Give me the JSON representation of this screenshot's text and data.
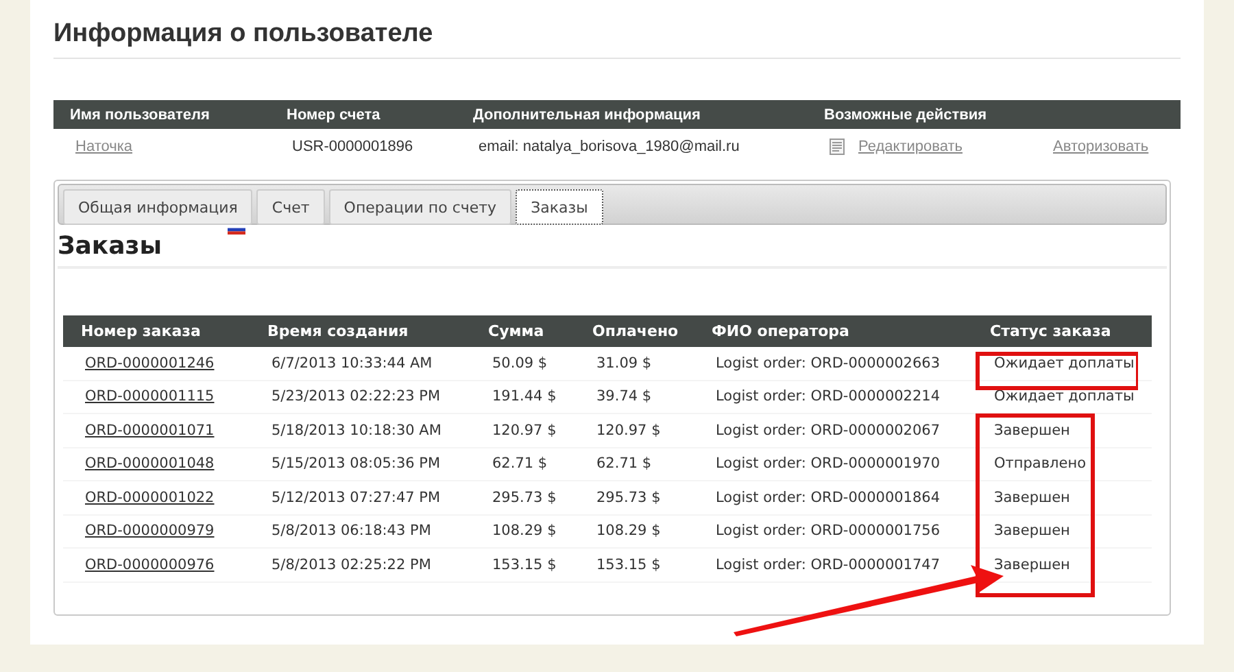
{
  "page_title": "Информация о пользователе",
  "user_table": {
    "columns": [
      "Имя пользователя",
      "Номер счета",
      "Дополнительная информация",
      "Возможные действия"
    ],
    "row": {
      "name": "Наточка",
      "account": "USR-0000001896",
      "info": "email: natalya_borisova_1980@mail.ru",
      "actions": [
        "Редактировать",
        "Авторизовать"
      ]
    }
  },
  "tabs": [
    {
      "label": "Общая информация",
      "selected": false
    },
    {
      "label": "Счет",
      "selected": false
    },
    {
      "label": "Операции по счету",
      "selected": false
    },
    {
      "label": "Заказы",
      "selected": true
    }
  ],
  "section_title": "Заказы",
  "orders": {
    "columns": [
      "Номер заказа",
      "Время создания",
      "Сумма",
      "Оплачено",
      "ФИО оператора",
      "Статус заказа"
    ],
    "rows": [
      [
        "ORD-0000001246",
        "6/7/2013 10:33:44 AM",
        "50.09 $",
        "31.09 $",
        "Logist order: ORD-0000002663",
        "Ожидает доплаты"
      ],
      [
        "ORD-0000001115",
        "5/23/2013 02:22:23 PM",
        "191.44 $",
        "39.74 $",
        "Logist order: ORD-0000002214",
        "Ожидает доплаты"
      ],
      [
        "ORD-0000001071",
        "5/18/2013 10:18:30 AM",
        "120.97 $",
        "120.97 $",
        "Logist order: ORD-0000002067",
        "Завершен"
      ],
      [
        "ORD-0000001048",
        "5/15/2013 08:05:36 PM",
        "62.71 $",
        "62.71 $",
        "Logist order: ORD-0000001970",
        "Отправлено"
      ],
      [
        "ORD-0000001022",
        "5/12/2013 07:27:47 PM",
        "295.73 $",
        "295.73 $",
        "Logist order: ORD-0000001864",
        "Завершен"
      ],
      [
        "ORD-0000000979",
        "5/8/2013 06:18:43 PM",
        "108.29 $",
        "108.29 $",
        "Logist order: ORD-0000001756",
        "Завершен"
      ],
      [
        "ORD-0000000976",
        "5/8/2013 02:25:22 PM",
        "153.15 $",
        "153.15 $",
        "Logist order: ORD-0000001747",
        "Завершен"
      ]
    ]
  }
}
